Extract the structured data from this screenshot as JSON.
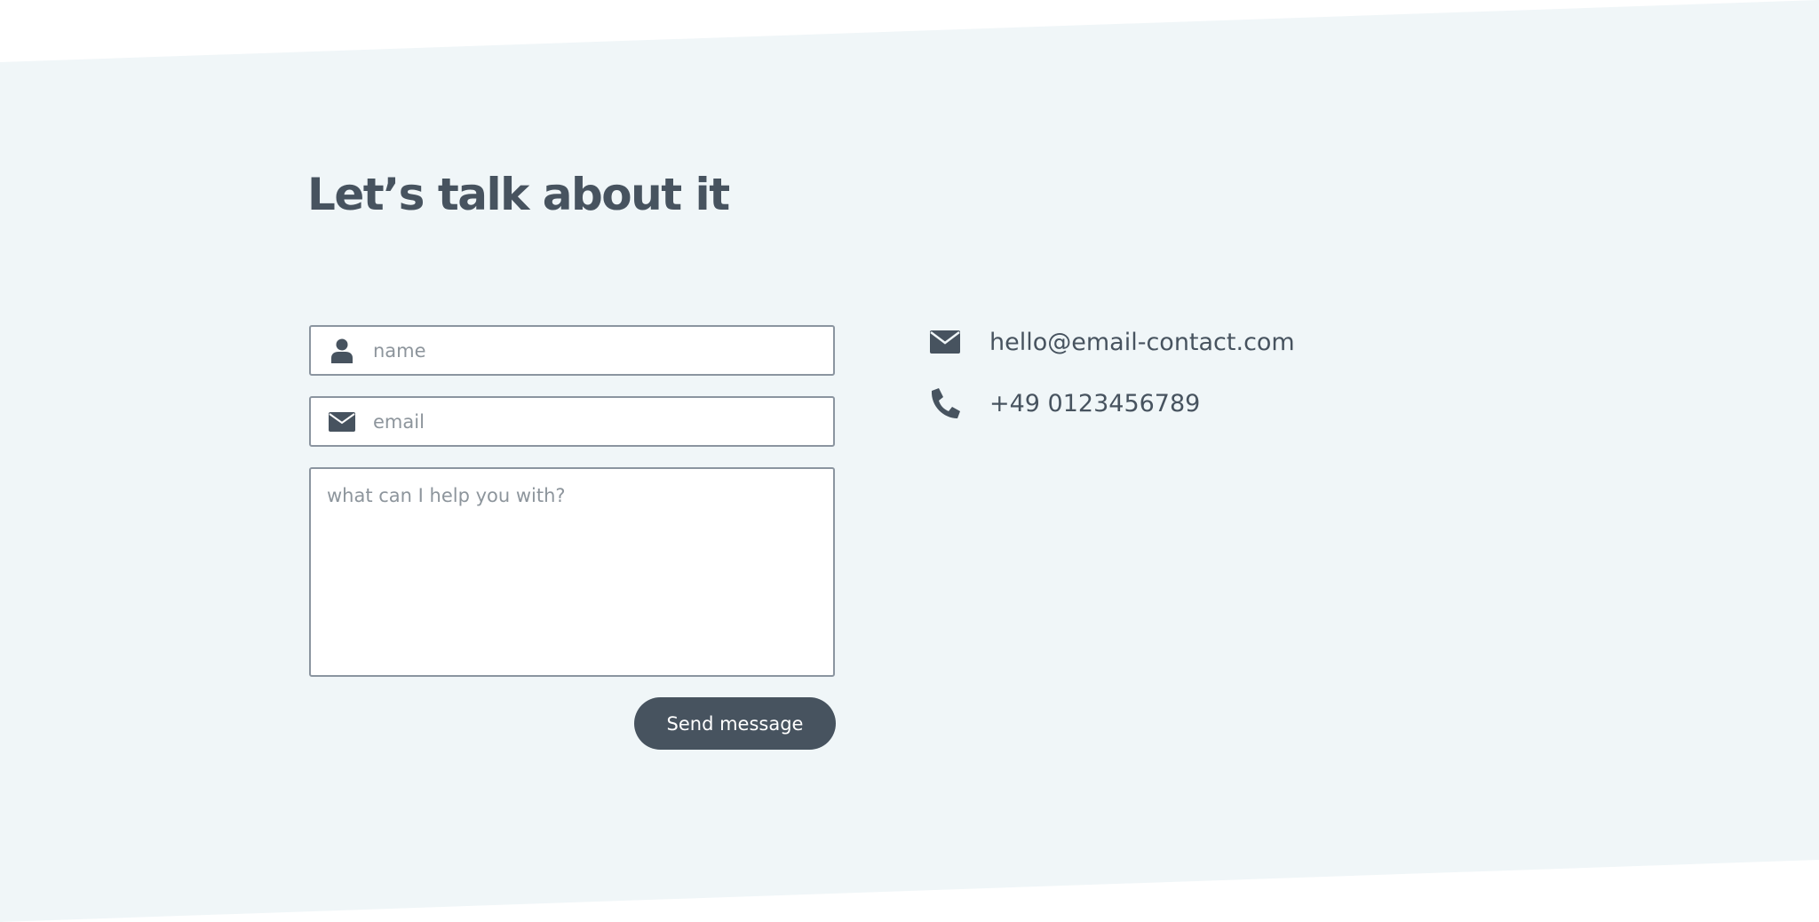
{
  "section": {
    "title": "Let’s talk about it"
  },
  "form": {
    "name_placeholder": "name",
    "email_placeholder": "email",
    "message_placeholder": "what can I help you with?",
    "send_label": "Send message"
  },
  "contact": {
    "email": "hello@email-contact.com",
    "phone": "+49 0123456789"
  },
  "colors": {
    "band_background": "#f0f6f8",
    "text_primary": "#47535f",
    "placeholder": "#8d959c",
    "field_border": "#8b95a0",
    "button_background": "#47535f",
    "button_text": "#ffffff"
  },
  "icons": {
    "name_field": "user-icon",
    "email_field": "envelope-icon",
    "contact_email": "envelope-icon",
    "contact_phone": "phone-icon"
  }
}
